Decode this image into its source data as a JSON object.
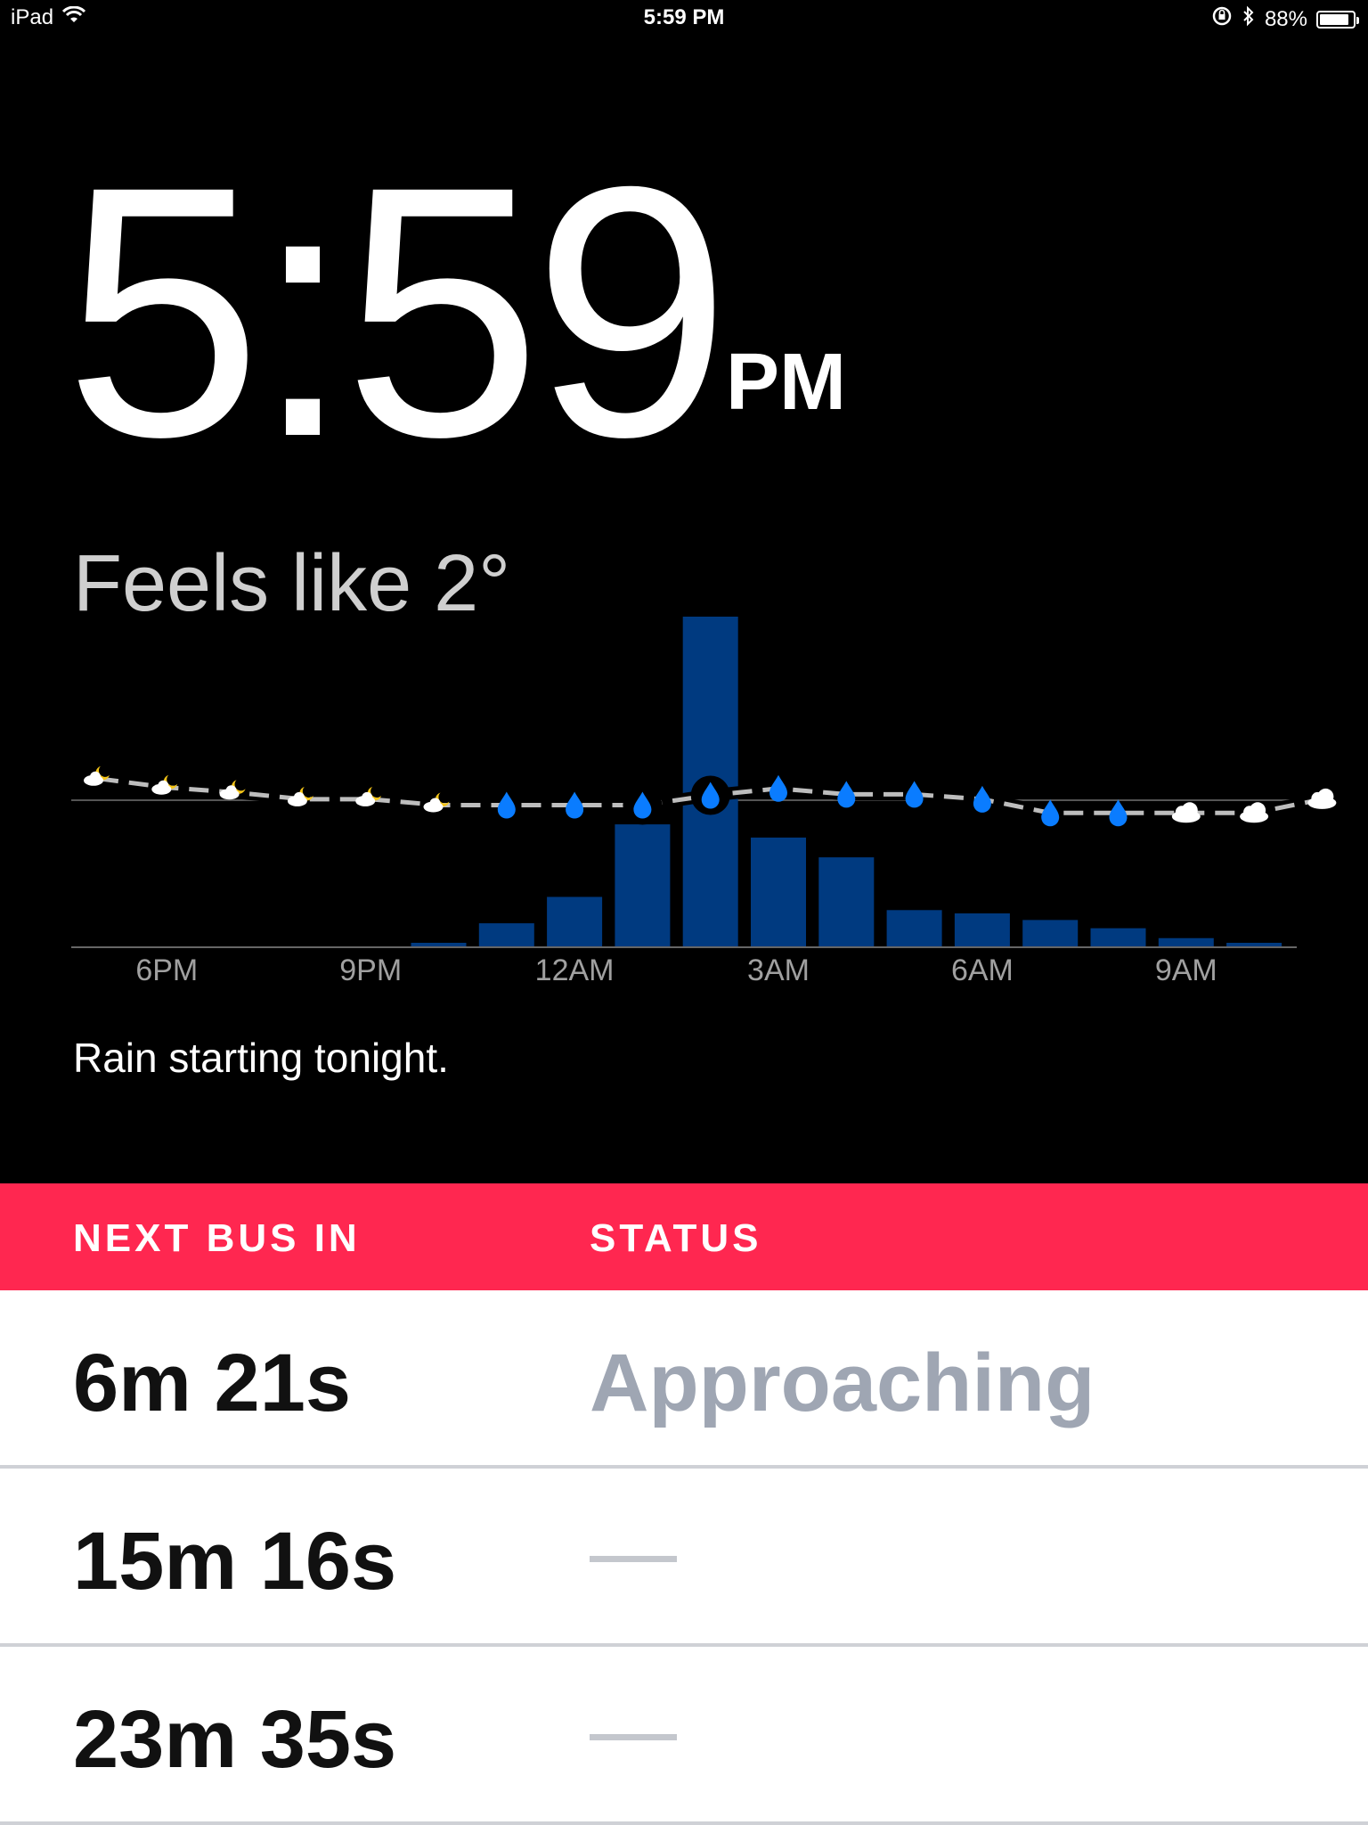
{
  "status_bar": {
    "device": "iPad",
    "time": "5:59 PM",
    "battery_percent": "88%",
    "battery_level": 0.88
  },
  "clock": {
    "time": "5:59",
    "ampm": "PM"
  },
  "weather": {
    "feels_like": "Feels like 2°",
    "summary": "Rain starting tonight."
  },
  "chart_data": {
    "type": "bar",
    "x_tick_labels": [
      "6PM",
      "9PM",
      "12AM",
      "3AM",
      "6AM",
      "9AM"
    ],
    "hours": [
      "5PM",
      "6PM",
      "7PM",
      "8PM",
      "9PM",
      "10PM",
      "11PM",
      "12AM",
      "1AM",
      "2AM",
      "3AM",
      "4AM",
      "5AM",
      "6AM",
      "7AM",
      "8AM",
      "9AM",
      "10AM",
      "11AM"
    ],
    "precipitation": [
      0,
      0,
      0,
      0,
      0,
      0.01,
      0.07,
      0.15,
      0.37,
      1.0,
      0.33,
      0.27,
      0.11,
      0.1,
      0.08,
      0.055,
      0.025,
      0.01,
      0
    ],
    "temperature": [
      2.2,
      1.3,
      0.8,
      0.1,
      0.1,
      -0.5,
      -0.5,
      -0.5,
      -0.5,
      0.5,
      1.2,
      0.6,
      0.6,
      0.1,
      -1.3,
      -1.3,
      -1.3,
      -1.3,
      0.1
    ],
    "conditions": [
      "night",
      "night",
      "night",
      "night",
      "night",
      "night",
      "rain",
      "rain",
      "rain",
      "rain",
      "rain",
      "rain",
      "rain",
      "rain",
      "rain",
      "rain",
      "cloud",
      "cloud",
      "cloud"
    ],
    "highlighted": [
      8,
      9
    ],
    "colors": {
      "bars": "#003a80",
      "rain_icon": "#0a7cff",
      "moon": "#f5c518",
      "temp_line": "#bdbdbd"
    }
  },
  "bus": {
    "headers": {
      "next": "NEXT BUS IN",
      "status": "STATUS"
    },
    "rows": [
      {
        "time": "6m 21s",
        "status": "Approaching"
      },
      {
        "time": "15m 16s",
        "status": ""
      },
      {
        "time": "23m 35s",
        "status": ""
      }
    ],
    "header_color": "#ff2750"
  }
}
